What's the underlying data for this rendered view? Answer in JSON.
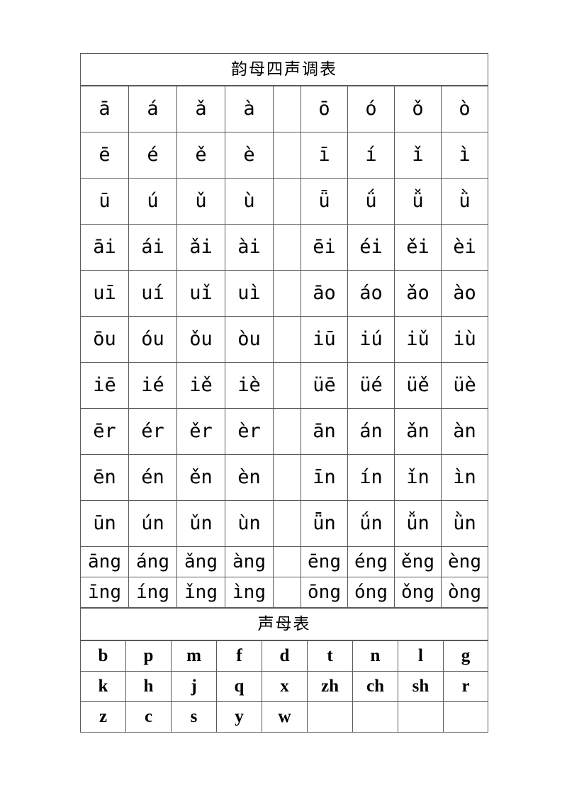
{
  "document": {
    "page_background": "#ffffff",
    "border_color": "#5a5a5a",
    "text_color": "#000000"
  },
  "finals_table": {
    "title": "韵母四声调表",
    "column_count": 9,
    "spacer_column_index": 4,
    "rows": [
      {
        "left": [
          "ā",
          "á",
          "ǎ",
          "à"
        ],
        "right": [
          "ō",
          "ó",
          "ǒ",
          "ò"
        ],
        "short": false
      },
      {
        "left": [
          "ē",
          "é",
          "ě",
          "è"
        ],
        "right": [
          "ī",
          "í",
          "ǐ",
          "ì"
        ],
        "short": false
      },
      {
        "left": [
          "ū",
          "ú",
          "ǔ",
          "ù"
        ],
        "right": [
          "ǖ",
          "ǘ",
          "ǚ",
          "ǜ"
        ],
        "short": false
      },
      {
        "left": [
          "āi",
          "ái",
          "ǎi",
          "ài"
        ],
        "right": [
          "ēi",
          "éi",
          "ěi",
          "èi"
        ],
        "short": false
      },
      {
        "left": [
          "uī",
          "uí",
          "uǐ",
          "uì"
        ],
        "right": [
          "āo",
          "áo",
          "ǎo",
          "ào"
        ],
        "short": false
      },
      {
        "left": [
          "ōu",
          "óu",
          "ǒu",
          "òu"
        ],
        "right": [
          "iū",
          "iú",
          "iǔ",
          "iù"
        ],
        "short": false
      },
      {
        "left": [
          "iē",
          "ié",
          "iě",
          "iè"
        ],
        "right": [
          "üē",
          "üé",
          "üě",
          "üè"
        ],
        "short": false
      },
      {
        "left": [
          "ēr",
          "ér",
          "ěr",
          "èr"
        ],
        "right": [
          "ān",
          "án",
          "ǎn",
          "àn"
        ],
        "short": false
      },
      {
        "left": [
          "ēn",
          "én",
          "ěn",
          "èn"
        ],
        "right": [
          "īn",
          "ín",
          "ǐn",
          "ìn"
        ],
        "short": false
      },
      {
        "left": [
          "ūn",
          "ún",
          "ǔn",
          "ùn"
        ],
        "right": [
          "ǖn",
          "ǘn",
          "ǚn",
          "ǜn"
        ],
        "short": false
      },
      {
        "left": [
          "āng",
          "áng",
          "ǎng",
          "àng"
        ],
        "right": [
          "ēng",
          "éng",
          "ěng",
          "èng"
        ],
        "short": true
      },
      {
        "left": [
          "īng",
          "íng",
          "ǐng",
          "ìng"
        ],
        "right": [
          "ōng",
          "óng",
          "ǒng",
          "òng"
        ],
        "short": true
      }
    ]
  },
  "initials_table": {
    "title": "声母表",
    "column_count": 9,
    "rows": [
      [
        "b",
        "p",
        "m",
        "f",
        "d",
        "t",
        "n",
        "l",
        "g"
      ],
      [
        "k",
        "h",
        "j",
        "q",
        "x",
        "zh",
        "ch",
        "sh",
        "r"
      ],
      [
        "z",
        "c",
        "s",
        "y",
        "w",
        "",
        "",
        "",
        ""
      ]
    ]
  }
}
